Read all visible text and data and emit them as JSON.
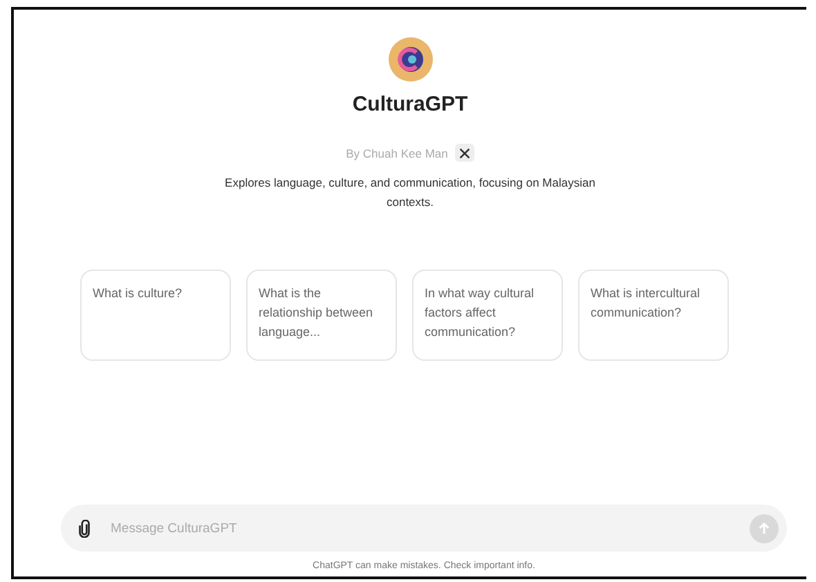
{
  "gpt": {
    "name": "CulturaGPT",
    "author": "By Chuah Kee Man",
    "description": "Explores language, culture, and communication, focusing on Malaysian contexts."
  },
  "suggestions": [
    "What is culture?",
    "What is the relationship between language...",
    "In what way cultural factors affect communication?",
    "What is intercultural communication?"
  ],
  "composer": {
    "placeholder": "Message CulturaGPT",
    "send_disabled": true
  },
  "footer": "ChatGPT can make mistakes. Check important info."
}
